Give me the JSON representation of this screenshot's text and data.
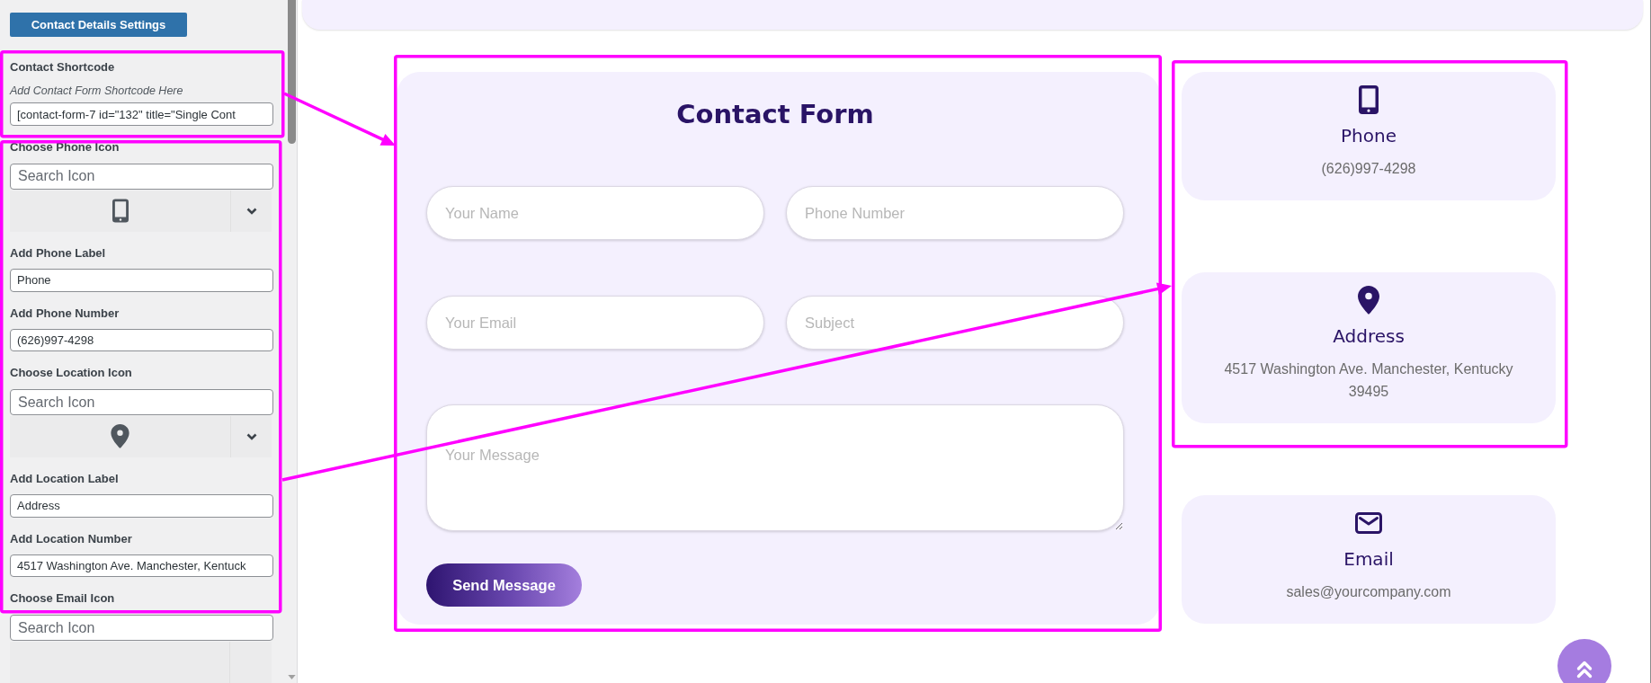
{
  "sidebar": {
    "settings_button": "Contact Details Settings",
    "shortcode": {
      "label": "Contact Shortcode",
      "hint": "Add Contact Form Shortcode Here",
      "value": "[contact-form-7 id=\"132\" title=\"Single Cont"
    },
    "phone": {
      "icon_label": "Choose Phone Icon",
      "icon_search": {
        "placeholder": "Search Icon"
      },
      "label_field": {
        "label": "Add Phone Label",
        "value": "Phone"
      },
      "number_field": {
        "label": "Add Phone Number",
        "value": "(626)997-4298"
      }
    },
    "location": {
      "icon_label": "Choose Location Icon",
      "icon_search": {
        "placeholder": "Search Icon"
      },
      "label_field": {
        "label": "Add Location Label",
        "value": "Address"
      },
      "number_field": {
        "label": "Add Location Number",
        "value": "4517 Washington Ave. Manchester, Kentuck"
      }
    },
    "email": {
      "icon_label": "Choose Email Icon",
      "icon_search": {
        "placeholder": "Search Icon"
      }
    }
  },
  "contact_form": {
    "title": "Contact Form",
    "fields": [
      {
        "placeholder": "Your Name"
      },
      {
        "placeholder": "Phone Number"
      },
      {
        "placeholder": "Your Email"
      },
      {
        "placeholder": "Subject"
      }
    ],
    "message": {
      "placeholder": "Your Message"
    },
    "submit_button": "Send Message"
  },
  "contact_cards": [
    {
      "kind": "phone",
      "title": "Phone",
      "text": "(626)997-4298"
    },
    {
      "kind": "address",
      "title": "Address",
      "text": "4517 Washington Ave. Manchester, Kentucky 39495"
    },
    {
      "kind": "email",
      "title": "Email",
      "text": "sales@yourcompany.com"
    }
  ]
}
